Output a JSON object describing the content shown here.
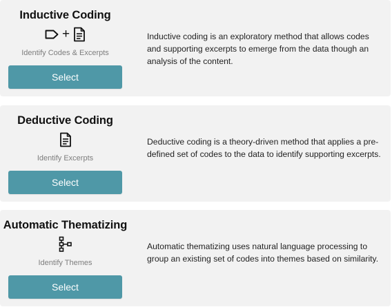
{
  "options": [
    {
      "title": "Inductive Coding",
      "icons": [
        "tag-icon",
        "document-icon"
      ],
      "plus": "+",
      "subtitle": "Identify Codes & Excerpts",
      "button_label": "Select",
      "description": "Inductive coding is an exploratory method that allows codes and supporting excerpts to emerge from the data though an analysis of the content."
    },
    {
      "title": "Deductive Coding",
      "icons": [
        "document-icon"
      ],
      "subtitle": "Identify Excerpts",
      "button_label": "Select",
      "description": "Deductive coding is a theory-driven method that applies a pre-defined set of codes to the data to identify supporting excerpts."
    },
    {
      "title": "Automatic Thematizing",
      "icons": [
        "hierarchy-icon"
      ],
      "subtitle": "Identify Themes",
      "button_label": "Select",
      "description": "Automatic thematizing uses natural language processing to group an existing set of codes into themes based on similarity."
    }
  ],
  "colors": {
    "button": "#4f98a7",
    "card_background": "#f2f2f2",
    "subtitle_text": "#7d7d7d"
  }
}
